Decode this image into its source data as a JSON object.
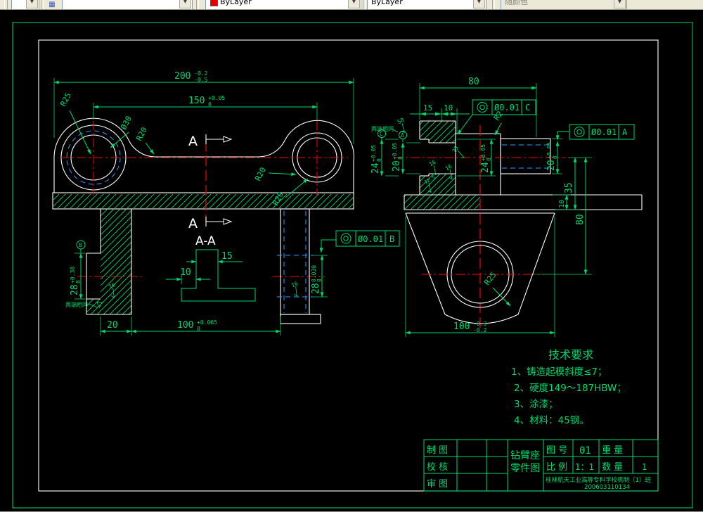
{
  "toolbar": {
    "color_value": "ByLayer",
    "linetype_value": "ByLayer",
    "plotstyle_value": "随颜色"
  },
  "front": {
    "d200": {
      "v": "200",
      "sup": "-0.2",
      "sub": "-0.5"
    },
    "d150": {
      "v": "150",
      "sup": "+0.05",
      "sub": "0"
    },
    "r25": "R25",
    "d30": "Ø30",
    "r20_fillet": "R20",
    "r20_a": "R20",
    "r20_b": "R20",
    "section_a_top": "A",
    "section_a_bottom": "A",
    "datum_b": "B",
    "d28_left": {
      "v": "28",
      "sup": "+0.30",
      "sub": "0"
    },
    "d28_right": {
      "v": "28",
      "sup": "0.030",
      "sub": "0"
    },
    "note_left": "两端相同",
    "sf16_left": "16",
    "sf16_right": "16",
    "d20": "20",
    "d100": {
      "v": "100",
      "sup": "+0.065",
      "sub": "0"
    },
    "gdt_b": {
      "tol": "Ø0.01",
      "datum": "B"
    }
  },
  "section_aa": {
    "title": "A-A",
    "d15": "15",
    "d10": "10"
  },
  "side": {
    "d80_top": "80",
    "d15": "15",
    "d10": "10",
    "gdt_c": {
      "tol": "Ø0.01",
      "datum": "C"
    },
    "gdt_a": {
      "tol": "Ø0.01",
      "datum": "A"
    },
    "r2": "R2",
    "d24_left": {
      "v": "24",
      "sup": "+0.05",
      "sub": "0"
    },
    "d20_left": {
      "v": "20",
      "sup": "+0.05",
      "sub": "0"
    },
    "d24_center": {
      "v": "24",
      "sup": "+0.05",
      "sub": "0"
    },
    "d20_right": {
      "v": "20",
      "sup": "+0.05",
      "sub": "0"
    },
    "datum_c": "C",
    "datum_a": "A",
    "sf50": "50",
    "sf25": "25",
    "sf16_a": "16",
    "sf16_b": "16",
    "sf125": "12.5",
    "note": "两端相同",
    "d35": "35",
    "d10_plate": "10",
    "d80_v": "80"
  },
  "bottom": {
    "r25": "R25",
    "d100": {
      "v": "100",
      "sup": "-0.3",
      "sub": "-0.2"
    }
  },
  "tech": {
    "title": "技术要求",
    "lines": [
      "1、铸造起模斜度≤7；",
      "2、硬度149～187HBW；",
      "3、涂漆；",
      "4、材料：45钢。"
    ]
  },
  "titleblock": {
    "draw_label": "制 图",
    "check_label": "校 核",
    "audit_label": "审 图",
    "part_name_1": "钻臂座",
    "part_name_2": "零件图",
    "drawing_no_label": "图 号",
    "drawing_no": "01",
    "weight_label": "重 量",
    "scale_label": "比 例",
    "scale": "1：1",
    "qty_label": "数 量",
    "qty": "1",
    "org": "桂林航天工业高等专科学校机制（1）班",
    "serial": "200603110134"
  }
}
